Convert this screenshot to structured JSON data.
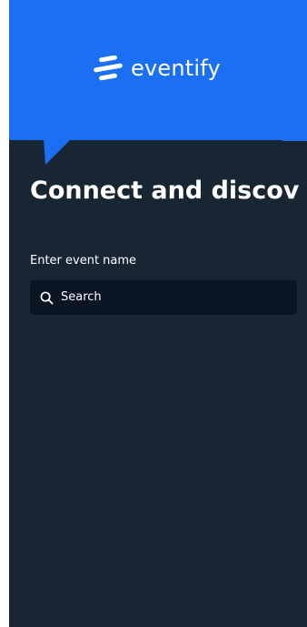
{
  "colors": {
    "header_blue": "#1b6ff2",
    "background_navy": "#182634",
    "search_field_bg": "#0a1524",
    "text": "#ffffff"
  },
  "header": {
    "brand_name": "eventify",
    "logo_icon": "eventify-logo-icon"
  },
  "main": {
    "headline": "Connect and discov",
    "search": {
      "label": "Enter event name",
      "placeholder": "Search",
      "icon": "search-icon"
    }
  }
}
